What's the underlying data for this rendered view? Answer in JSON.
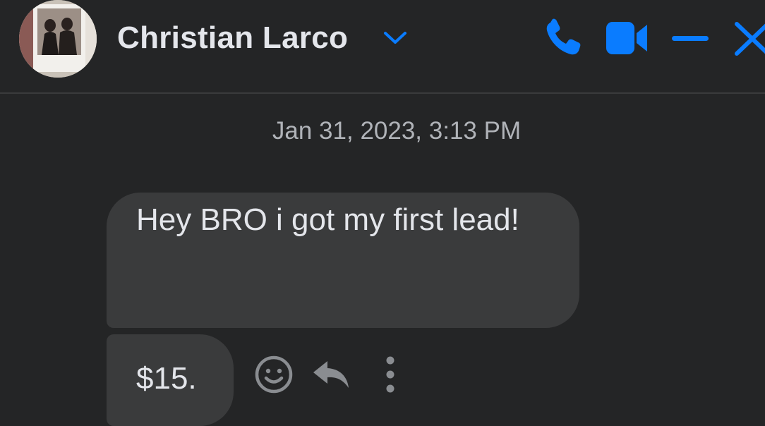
{
  "header": {
    "contact_name": "Christian Larco",
    "accent_color": "#0a7cff",
    "icons": [
      "chevron-down-icon",
      "phone-icon",
      "video-camera-icon",
      "minimize-icon",
      "close-icon"
    ]
  },
  "conversation": {
    "timestamp": "Jan 31, 2023, 3:13 PM",
    "messages": [
      {
        "text": "Hey BRO i got my first lead!"
      },
      {
        "text": "$15."
      }
    ],
    "message_actions": [
      "react-emoji-icon",
      "reply-icon",
      "more-options-icon"
    ]
  },
  "colors": {
    "background": "#242526",
    "bubble": "#3a3b3c",
    "text": "#e4e6eb",
    "muted_text": "#b0b3b8",
    "action_icon": "#8a8d91"
  }
}
